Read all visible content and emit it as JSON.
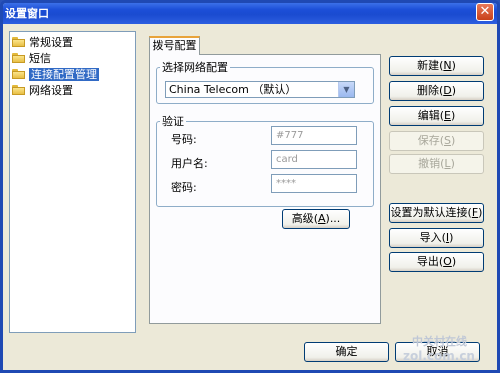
{
  "window": {
    "title": "设置窗口",
    "close_glyph": "✕"
  },
  "tree": {
    "items": [
      {
        "label": "常规设置",
        "selected": false
      },
      {
        "label": "短信",
        "selected": false
      },
      {
        "label": "连接配置管理",
        "selected": true
      },
      {
        "label": "网络设置",
        "selected": false
      }
    ]
  },
  "tab": {
    "label": "拨号配置"
  },
  "network": {
    "group_label": "选择网络配置",
    "selected": "China Telecom （默认）",
    "arrow_glyph": "▼"
  },
  "auth": {
    "group_label": "验证",
    "fields": [
      {
        "label": "号码:",
        "value": "#777"
      },
      {
        "label": "用户名:",
        "value": "card"
      },
      {
        "label": "密码:",
        "value": "****"
      }
    ]
  },
  "advanced_button": {
    "text": "高级",
    "hotkey": "A",
    "suffix": "..."
  },
  "side_buttons": [
    {
      "text": "新建",
      "hotkey": "N",
      "enabled": true
    },
    {
      "text": "删除",
      "hotkey": "D",
      "enabled": true
    },
    {
      "text": "编辑",
      "hotkey": "E",
      "enabled": true
    },
    {
      "text": "保存",
      "hotkey": "S",
      "enabled": false
    },
    {
      "text": "撤销",
      "hotkey": "L",
      "enabled": false
    },
    {
      "text": "设置为默认连接",
      "hotkey": "F",
      "enabled": true
    },
    {
      "text": "导入",
      "hotkey": "I",
      "enabled": true
    },
    {
      "text": "导出",
      "hotkey": "O",
      "enabled": true
    }
  ],
  "footer": {
    "ok": {
      "text": "确定"
    },
    "cancel": {
      "text": "取消"
    }
  },
  "watermark": {
    "line1": "中关村在线",
    "line2": "zol.com.cn"
  }
}
